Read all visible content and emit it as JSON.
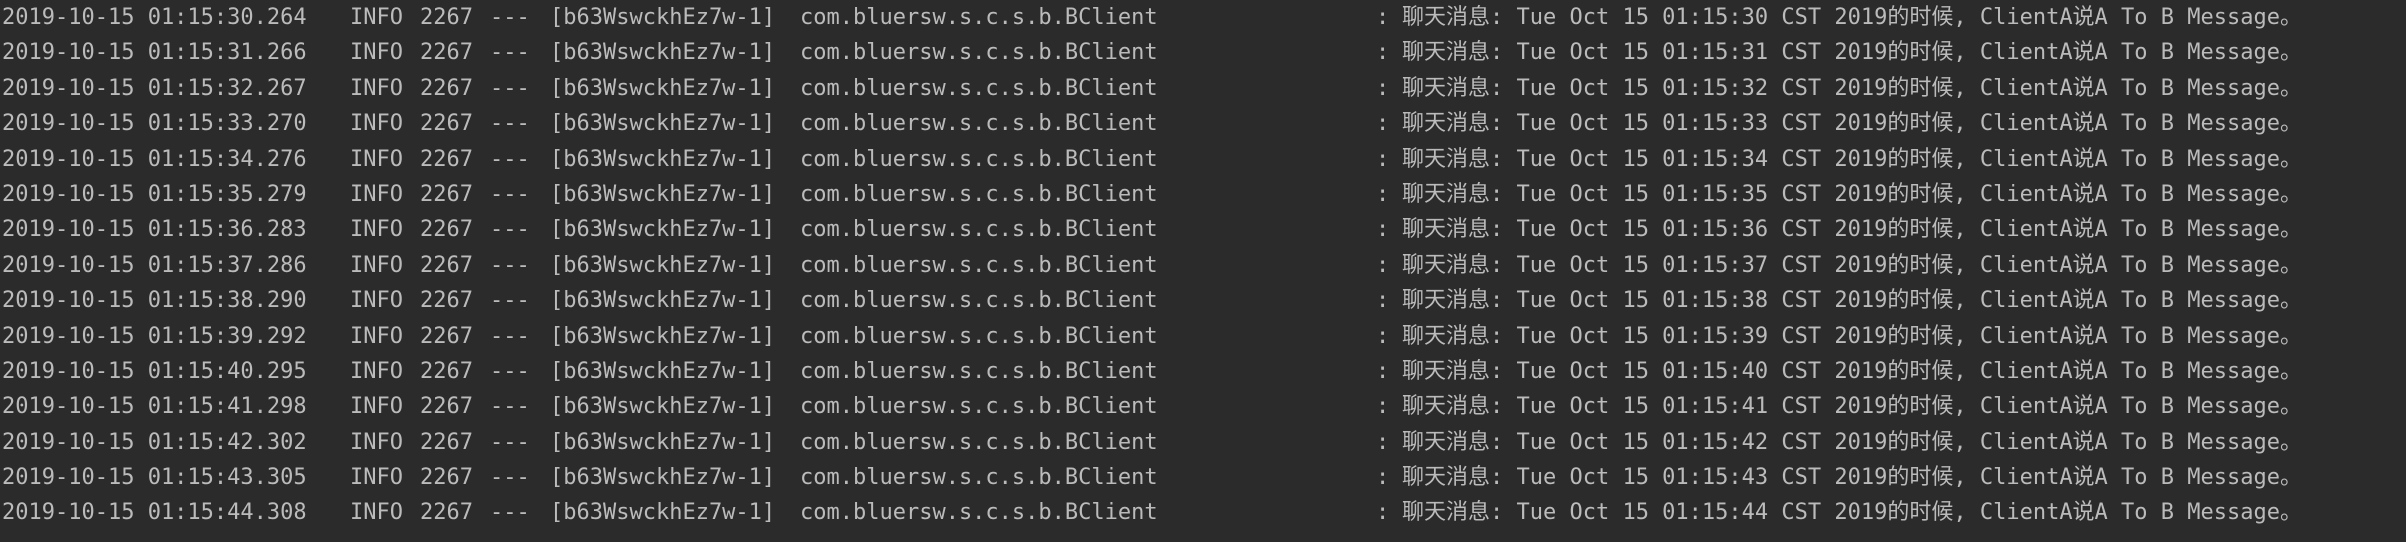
{
  "console": {
    "lines": [
      {
        "timestamp": "2019-10-15 01:15:30.264",
        "level": "INFO",
        "pid": "2267",
        "sep": "---",
        "thread": "[b63WswckhEz7w-1]",
        "logger": "com.bluersw.s.c.s.b.BClient",
        "colon": ":",
        "message": "聊天消息: Tue Oct 15 01:15:30 CST 2019的时候, ClientA说A To B Message。"
      },
      {
        "timestamp": "2019-10-15 01:15:31.266",
        "level": "INFO",
        "pid": "2267",
        "sep": "---",
        "thread": "[b63WswckhEz7w-1]",
        "logger": "com.bluersw.s.c.s.b.BClient",
        "colon": ":",
        "message": "聊天消息: Tue Oct 15 01:15:31 CST 2019的时候, ClientA说A To B Message。"
      },
      {
        "timestamp": "2019-10-15 01:15:32.267",
        "level": "INFO",
        "pid": "2267",
        "sep": "---",
        "thread": "[b63WswckhEz7w-1]",
        "logger": "com.bluersw.s.c.s.b.BClient",
        "colon": ":",
        "message": "聊天消息: Tue Oct 15 01:15:32 CST 2019的时候, ClientA说A To B Message。"
      },
      {
        "timestamp": "2019-10-15 01:15:33.270",
        "level": "INFO",
        "pid": "2267",
        "sep": "---",
        "thread": "[b63WswckhEz7w-1]",
        "logger": "com.bluersw.s.c.s.b.BClient",
        "colon": ":",
        "message": "聊天消息: Tue Oct 15 01:15:33 CST 2019的时候, ClientA说A To B Message。"
      },
      {
        "timestamp": "2019-10-15 01:15:34.276",
        "level": "INFO",
        "pid": "2267",
        "sep": "---",
        "thread": "[b63WswckhEz7w-1]",
        "logger": "com.bluersw.s.c.s.b.BClient",
        "colon": ":",
        "message": "聊天消息: Tue Oct 15 01:15:34 CST 2019的时候, ClientA说A To B Message。"
      },
      {
        "timestamp": "2019-10-15 01:15:35.279",
        "level": "INFO",
        "pid": "2267",
        "sep": "---",
        "thread": "[b63WswckhEz7w-1]",
        "logger": "com.bluersw.s.c.s.b.BClient",
        "colon": ":",
        "message": "聊天消息: Tue Oct 15 01:15:35 CST 2019的时候, ClientA说A To B Message。"
      },
      {
        "timestamp": "2019-10-15 01:15:36.283",
        "level": "INFO",
        "pid": "2267",
        "sep": "---",
        "thread": "[b63WswckhEz7w-1]",
        "logger": "com.bluersw.s.c.s.b.BClient",
        "colon": ":",
        "message": "聊天消息: Tue Oct 15 01:15:36 CST 2019的时候, ClientA说A To B Message。"
      },
      {
        "timestamp": "2019-10-15 01:15:37.286",
        "level": "INFO",
        "pid": "2267",
        "sep": "---",
        "thread": "[b63WswckhEz7w-1]",
        "logger": "com.bluersw.s.c.s.b.BClient",
        "colon": ":",
        "message": "聊天消息: Tue Oct 15 01:15:37 CST 2019的时候, ClientA说A To B Message。"
      },
      {
        "timestamp": "2019-10-15 01:15:38.290",
        "level": "INFO",
        "pid": "2267",
        "sep": "---",
        "thread": "[b63WswckhEz7w-1]",
        "logger": "com.bluersw.s.c.s.b.BClient",
        "colon": ":",
        "message": "聊天消息: Tue Oct 15 01:15:38 CST 2019的时候, ClientA说A To B Message。"
      },
      {
        "timestamp": "2019-10-15 01:15:39.292",
        "level": "INFO",
        "pid": "2267",
        "sep": "---",
        "thread": "[b63WswckhEz7w-1]",
        "logger": "com.bluersw.s.c.s.b.BClient",
        "colon": ":",
        "message": "聊天消息: Tue Oct 15 01:15:39 CST 2019的时候, ClientA说A To B Message。"
      },
      {
        "timestamp": "2019-10-15 01:15:40.295",
        "level": "INFO",
        "pid": "2267",
        "sep": "---",
        "thread": "[b63WswckhEz7w-1]",
        "logger": "com.bluersw.s.c.s.b.BClient",
        "colon": ":",
        "message": "聊天消息: Tue Oct 15 01:15:40 CST 2019的时候, ClientA说A To B Message。"
      },
      {
        "timestamp": "2019-10-15 01:15:41.298",
        "level": "INFO",
        "pid": "2267",
        "sep": "---",
        "thread": "[b63WswckhEz7w-1]",
        "logger": "com.bluersw.s.c.s.b.BClient",
        "colon": ":",
        "message": "聊天消息: Tue Oct 15 01:15:41 CST 2019的时候, ClientA说A To B Message。"
      },
      {
        "timestamp": "2019-10-15 01:15:42.302",
        "level": "INFO",
        "pid": "2267",
        "sep": "---",
        "thread": "[b63WswckhEz7w-1]",
        "logger": "com.bluersw.s.c.s.b.BClient",
        "colon": ":",
        "message": "聊天消息: Tue Oct 15 01:15:42 CST 2019的时候, ClientA说A To B Message。"
      },
      {
        "timestamp": "2019-10-15 01:15:43.305",
        "level": "INFO",
        "pid": "2267",
        "sep": "---",
        "thread": "[b63WswckhEz7w-1]",
        "logger": "com.bluersw.s.c.s.b.BClient",
        "colon": ":",
        "message": "聊天消息: Tue Oct 15 01:15:43 CST 2019的时候, ClientA说A To B Message。"
      },
      {
        "timestamp": "2019-10-15 01:15:44.308",
        "level": "INFO",
        "pid": "2267",
        "sep": "---",
        "thread": "[b63WswckhEz7w-1]",
        "logger": "com.bluersw.s.c.s.b.BClient",
        "colon": ":",
        "message": "聊天消息: Tue Oct 15 01:15:44 CST 2019的时候, ClientA说A To B Message。"
      }
    ]
  },
  "colors": {
    "background": "#2b2b2b",
    "text": "#bbbbbb"
  }
}
